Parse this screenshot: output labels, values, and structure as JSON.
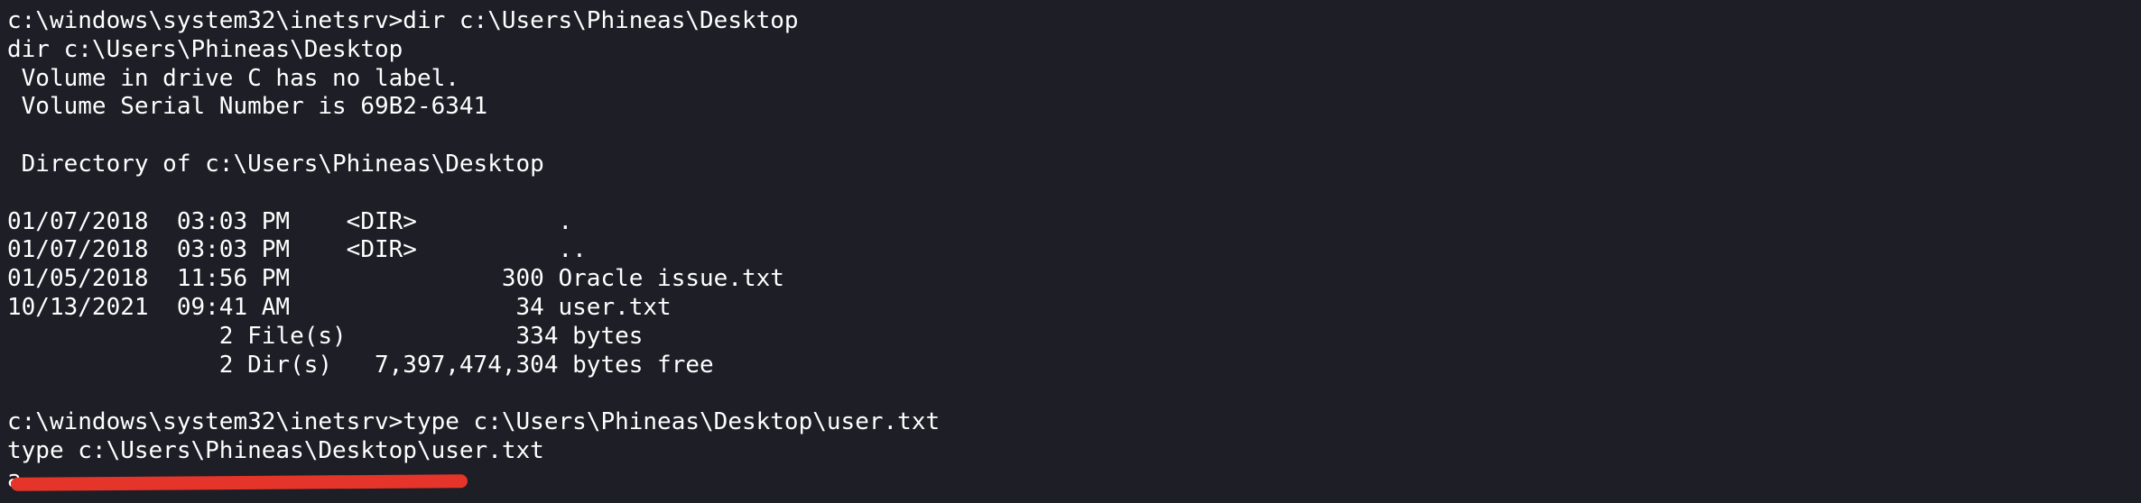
{
  "terminal": {
    "lines": [
      "c:\\windows\\system32\\inetsrv>dir c:\\Users\\Phineas\\Desktop",
      "dir c:\\Users\\Phineas\\Desktop",
      " Volume in drive C has no label.",
      " Volume Serial Number is 69B2-6341",
      "",
      " Directory of c:\\Users\\Phineas\\Desktop",
      "",
      "01/07/2018  03:03 PM    <DIR>          .",
      "01/07/2018  03:03 PM    <DIR>          ..",
      "01/05/2018  11:56 PM               300 Oracle issue.txt",
      "10/13/2021  09:41 AM                34 user.txt",
      "               2 File(s)            334 bytes",
      "               2 Dir(s)   7,397,474,304 bytes free",
      "",
      "c:\\windows\\system32\\inetsrv>type c:\\Users\\Phineas\\Desktop\\user.txt",
      "type c:\\Users\\Phineas\\Desktop\\user.txt",
      "a"
    ]
  },
  "colors": {
    "background": "#1d1e26",
    "text": "#ffffff",
    "redaction": "#e5342a"
  }
}
